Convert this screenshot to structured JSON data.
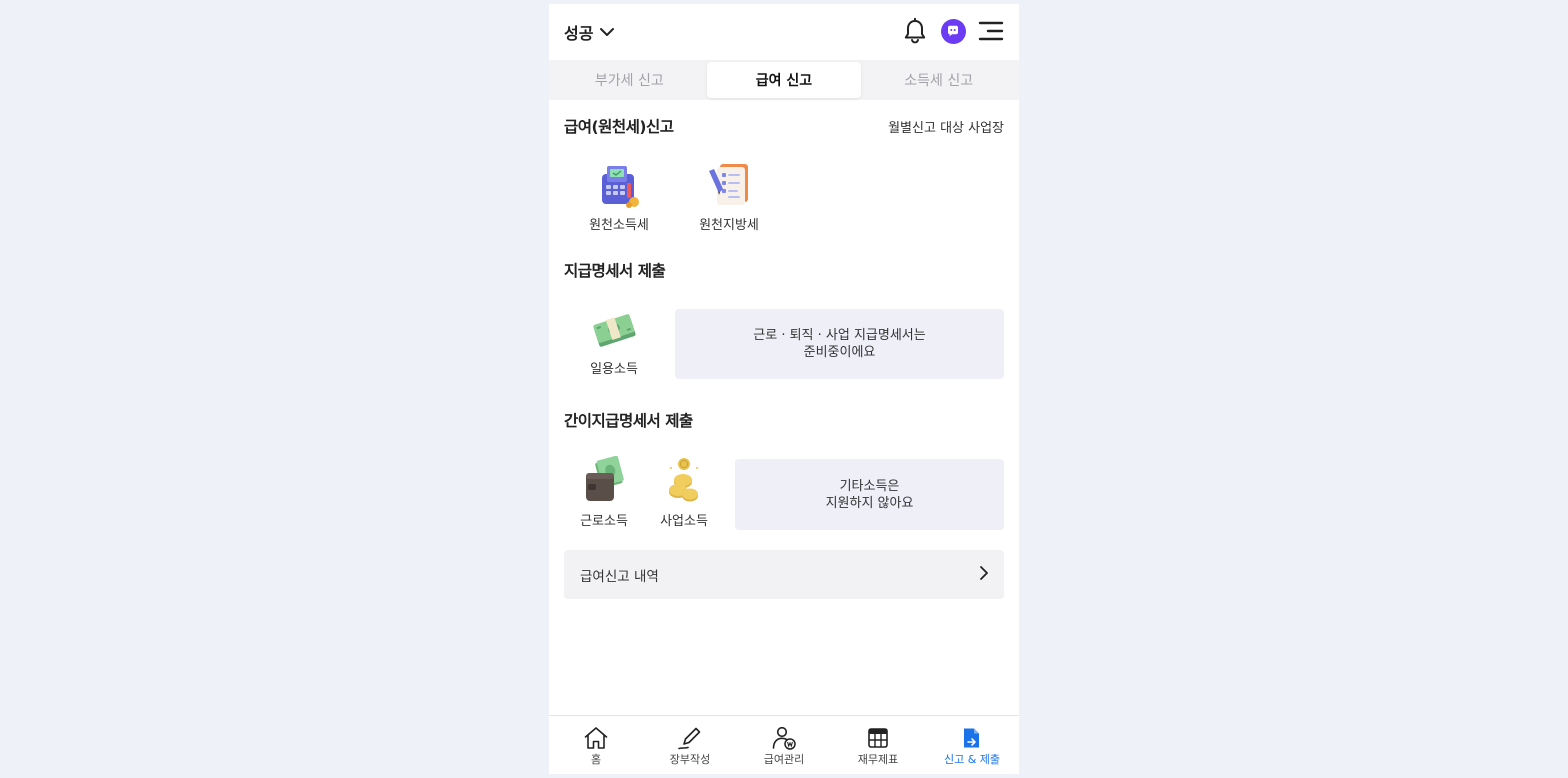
{
  "header": {
    "company_name": "성공"
  },
  "tabs": [
    {
      "label": "부가세 신고",
      "active": false
    },
    {
      "label": "급여 신고",
      "active": true
    },
    {
      "label": "소득세 신고",
      "active": false
    }
  ],
  "withholding": {
    "title": "급여(원천세)신고",
    "link": "월별신고 대상 사업장",
    "items": [
      {
        "label": "원천소득세",
        "icon": "payment-terminal-icon"
      },
      {
        "label": "원천지방세",
        "icon": "document-checklist-icon"
      }
    ]
  },
  "payment_statement": {
    "title": "지급명세서 제출",
    "items": [
      {
        "label": "일용소득",
        "icon": "cash-bundle-icon"
      }
    ],
    "notice_line1": "근로 · 퇴직 · 사업 지급명세서는",
    "notice_line2": "준비중이에요"
  },
  "simple_statement": {
    "title": "간이지급명세서 제출",
    "items": [
      {
        "label": "근로소득",
        "icon": "wallet-cash-icon"
      },
      {
        "label": "사업소득",
        "icon": "coin-stack-icon"
      }
    ],
    "notice_line1": "기타소득은",
    "notice_line2": "지원하지 않아요"
  },
  "history": {
    "label": "급여신고 내역"
  },
  "bottom_nav": [
    {
      "label": "홈",
      "icon": "home-icon",
      "active": false
    },
    {
      "label": "장부작성",
      "icon": "pen-icon",
      "active": false
    },
    {
      "label": "급여관리",
      "icon": "payroll-user-icon",
      "active": false
    },
    {
      "label": "재무제표",
      "icon": "table-icon",
      "active": false
    },
    {
      "label": "신고 & 제출",
      "icon": "file-submit-icon",
      "active": true
    }
  ],
  "colors": {
    "accent": "#1a73e8",
    "avatar": "#6c3bf4",
    "background": "#eef1f8",
    "notice_bg": "#eeeff7"
  }
}
